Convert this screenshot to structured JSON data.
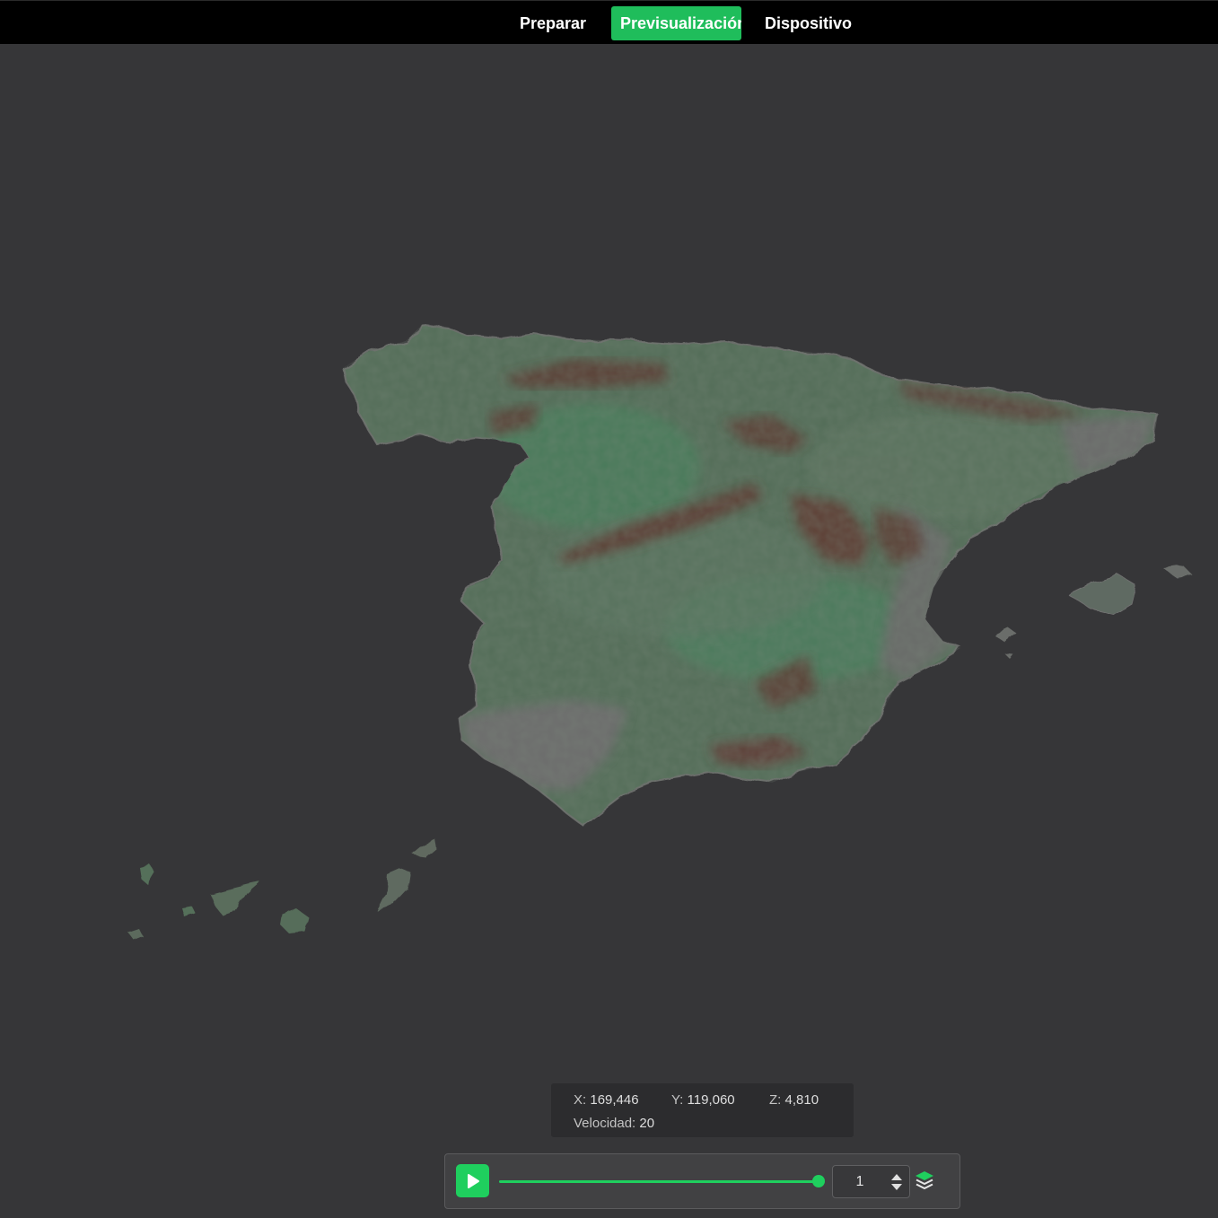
{
  "tabs": [
    {
      "label": "Preparar",
      "active": false
    },
    {
      "label": "Previsualización",
      "active": true
    },
    {
      "label": "Dispositivo",
      "active": false
    }
  ],
  "coordinates": {
    "x_label": "X:",
    "x_value": "169,446",
    "y_label": "Y:",
    "y_value": "119,060",
    "z_label": "Z:",
    "z_value": "4,810",
    "speed_label": "Velocidad:",
    "speed_value": "20"
  },
  "player": {
    "play_icon": "play-icon",
    "layers_icon": "layers-icon",
    "progress_fraction": 1.0,
    "layer_value": "1"
  },
  "colors": {
    "accent": "#1fcf5e",
    "background": "#363638",
    "topbar": "#000000",
    "terrain_low": "#4e7257",
    "terrain_high": "#5c3b33",
    "terrain_coast": "#6a6a6a"
  }
}
